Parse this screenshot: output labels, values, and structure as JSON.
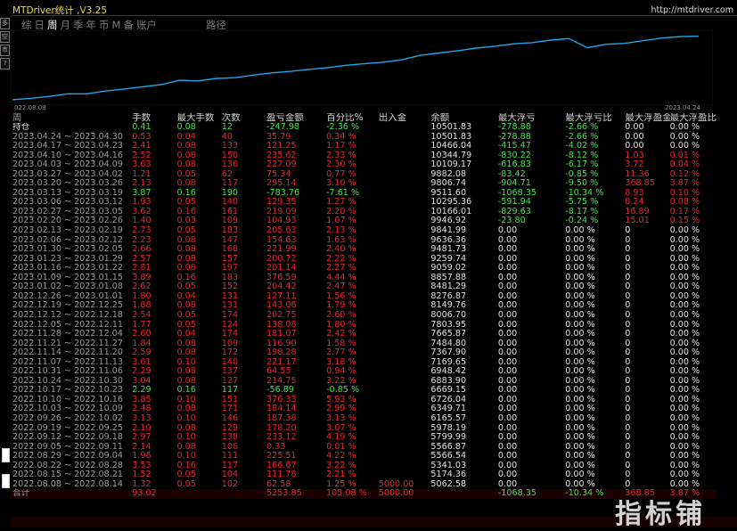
{
  "app": {
    "title": "MTDriver统计 ,V3.25",
    "url": "http://mtdriver.com"
  },
  "period_tabs": [
    {
      "label": "综",
      "active": false
    },
    {
      "label": "日",
      "active": false
    },
    {
      "label": "周",
      "active": true
    },
    {
      "label": "月",
      "active": false
    },
    {
      "label": "季",
      "active": false
    },
    {
      "label": "年",
      "active": false
    },
    {
      "label": "币",
      "active": false
    },
    {
      "label": "M",
      "active": false
    },
    {
      "label": "备",
      "active": false
    },
    {
      "label": "账户",
      "active": false
    }
  ],
  "extra_tab": "路径",
  "side_icons": [
    "多",
    "空",
    "市",
    "?"
  ],
  "chart": {
    "date_left": "022.08.08",
    "date_right": "2023.04.24",
    "line_color": "#1ea6e8"
  },
  "chart_data": {
    "type": "line",
    "x_range": [
      "2022.08.08",
      "2023.04.24"
    ],
    "values": [
      0,
      1,
      2,
      3,
      4,
      5,
      6,
      7,
      8,
      9,
      10,
      11,
      12,
      13,
      14,
      15,
      16,
      17,
      18,
      19,
      20,
      21,
      22,
      23,
      24,
      25,
      26,
      27,
      28,
      29,
      30,
      31,
      32,
      33,
      34,
      35,
      36
    ],
    "note_values_equity": [
      5062.58,
      5174.36,
      5341.03,
      5566.54,
      5566.87,
      5799.99,
      5978.19,
      6165.57,
      6349.71,
      6726.04,
      6669.15,
      6883.9,
      6948.42,
      7169.65,
      7367.9,
      7484.8,
      7665.87,
      7803.95,
      8006.7,
      8149.76,
      8276.87,
      8481.29,
      8857.88,
      9059.02,
      9259.74,
      9481.73,
      9636.36,
      9841.99,
      9946.92,
      10166.01,
      10295.36,
      9511.6,
      9806.74,
      9882.08,
      10109.17,
      10344.79,
      10466.04,
      10501.83
    ]
  },
  "table": {
    "headers": [
      "周",
      "手数",
      "最大手数",
      "次数",
      "盈亏金额",
      "百分比%",
      "出入金",
      "余额",
      "最大浮亏",
      "最大浮亏比",
      "最大浮盈金额",
      "最大浮盈比例"
    ],
    "open": {
      "label": "持仓",
      "lots": "0.41",
      "max_lots": "0.08",
      "count": "12",
      "pnl": "-247.98",
      "pct": "-2.36 %",
      "io": "",
      "balance": "10501.83",
      "max_float_loss": "-278.88",
      "max_float_loss_pct": "-2.66 %",
      "max_float_profit": "0.00",
      "max_float_profit_pct": "0.00 %"
    },
    "rows": [
      [
        "2023.04.24 ~ 2023.04.30",
        "0.53",
        "0.04",
        "40",
        "35.79",
        "0.34 %",
        "",
        "10501.83",
        "-278.88",
        "-2.66 %",
        "0.00",
        "0.00 %"
      ],
      [
        "2023.04.17 ~ 2023.04.23",
        "2.41",
        "0.08",
        "133",
        "121.25",
        "1.17 %",
        "",
        "10466.04",
        "-415.47",
        "-4.02 %",
        "0.00",
        "0.00 %"
      ],
      [
        "2023.04.10 ~ 2023.04.16",
        "2.52",
        "0.08",
        "150",
        "235.62",
        "2.33 %",
        "",
        "10344.79",
        "-830.22",
        "-8.12 %",
        "1.03",
        "0.01 %"
      ],
      [
        "2023.04.03 ~ 2023.04.09",
        "3.63",
        "0.08",
        "136",
        "227.09",
        "2.30 %",
        "",
        "10109.17",
        "-616.83",
        "-6.17 %",
        "3.72",
        "0.04 %"
      ],
      [
        "2023.03.27 ~ 2023.04.02",
        "1.21",
        "0.05",
        "62",
        "75.34",
        "0.77 %",
        "",
        "9882.08",
        "-83.42",
        "-0.85 %",
        "11.36",
        "0.12 %"
      ],
      [
        "2023.03.20 ~ 2023.03.26",
        "2.13",
        "0.08",
        "117",
        "295.14",
        "3.10 %",
        "",
        "9806.74",
        "-904.71",
        "-9.50 %",
        "368.85",
        "3.87 %"
      ],
      [
        "2023.03.13 ~ 2023.03.19",
        "3.87",
        "0.16",
        "190",
        "-783.76",
        "-7.61 %",
        "",
        "9511.60",
        "-1068.35",
        "-10.34 %",
        "8.93",
        "0.10 %"
      ],
      [
        "2023.03.06 ~ 2023.03.12",
        "1.93",
        "0.05",
        "140",
        "129.35",
        "1.27 %",
        "",
        "10295.36",
        "-591.94",
        "-5.75 %",
        "8.24",
        "0.08 %"
      ],
      [
        "2023.02.27 ~ 2023.03.05",
        "3.62",
        "0.16",
        "161",
        "219.09",
        "2.20 %",
        "",
        "10166.01",
        "-829.63",
        "-8.17 %",
        "16.89",
        "0.17 %"
      ],
      [
        "2023.02.20 ~ 2023.02.26",
        "1.40",
        "0.03",
        "109",
        "104.93",
        "1.07 %",
        "",
        "9946.92",
        "-23.80",
        "-0.24 %",
        "15.01",
        "0.15 %"
      ],
      [
        "2023.02.13 ~ 2023.02.19",
        "2.73",
        "0.05",
        "183",
        "205.63",
        "2.13 %",
        "",
        "9841.99",
        "0.00",
        "0.00 %",
        "0",
        "0.00 %"
      ],
      [
        "2023.02.06 ~ 2023.02.12",
        "2.23",
        "0.08",
        "147",
        "154.63",
        "1.63 %",
        "",
        "9636.36",
        "0.00",
        "0.00 %",
        "0",
        "0.00 %"
      ],
      [
        "2023.01.30 ~ 2023.02.05",
        "2.66",
        "0.08",
        "168",
        "221.99",
        "2.40 %",
        "",
        "9481.73",
        "0.00",
        "0.00 %",
        "0",
        "0.00 %"
      ],
      [
        "2023.01.23 ~ 2023.01.29",
        "2.57",
        "0.08",
        "157",
        "200.72",
        "2.22 %",
        "",
        "9259.74",
        "0.00",
        "0.00 %",
        "0",
        "0.00 %"
      ],
      [
        "2023.01.16 ~ 2023.01.22",
        "2.81",
        "0.08",
        "197",
        "201.14",
        "2.27 %",
        "",
        "9059.02",
        "0.00",
        "0.00 %",
        "0",
        "0.00 %"
      ],
      [
        "2023.01.09 ~ 2023.01.15",
        "3.89",
        "0.16",
        "183",
        "376.59",
        "4.44 %",
        "",
        "8857.88",
        "0.00",
        "0.00 %",
        "0",
        "0.00 %"
      ],
      [
        "2023.01.02 ~ 2023.01.08",
        "2.62",
        "0.05",
        "152",
        "204.42",
        "2.47 %",
        "",
        "8481.29",
        "0.00",
        "0.00 %",
        "0",
        "0.00 %"
      ],
      [
        "2022.12.26 ~ 2023.01.01",
        "1.80",
        "0.04",
        "131",
        "127.11",
        "1.56 %",
        "",
        "8276.87",
        "0.00",
        "0.00 %",
        "0",
        "0.00 %"
      ],
      [
        "2022.12.19 ~ 2022.12.25",
        "1.88",
        "0.08",
        "131",
        "143.06",
        "1.79 %",
        "",
        "8149.76",
        "0.00",
        "0.00 %",
        "0",
        "0.00 %"
      ],
      [
        "2022.12.12 ~ 2022.12.18",
        "2.54",
        "0.05",
        "174",
        "202.75",
        "2.60 %",
        "",
        "8006.70",
        "0.00",
        "0.00 %",
        "0",
        "0.00 %"
      ],
      [
        "2022.12.05 ~ 2022.12.11",
        "1.77",
        "0.05",
        "124",
        "138.08",
        "1.80 %",
        "",
        "7803.95",
        "0.00",
        "0.00 %",
        "0",
        "0.00 %"
      ],
      [
        "2022.11.28 ~ 2022.12.04",
        "2.60",
        "0.04",
        "174",
        "181.07",
        "2.42 %",
        "",
        "7665.87",
        "0.00",
        "0.00 %",
        "0",
        "0.00 %"
      ],
      [
        "2022.11.21 ~ 2022.11.27",
        "1.84",
        "0.08",
        "109",
        "116.90",
        "1.58 %",
        "",
        "7484.80",
        "0.00",
        "0.00 %",
        "0",
        "0.00 %"
      ],
      [
        "2022.11.14 ~ 2022.11.20",
        "2.59",
        "0.08",
        "172",
        "198.28",
        "2.77 %",
        "",
        "7367.90",
        "0.00",
        "0.00 %",
        "0",
        "0.00 %"
      ],
      [
        "2022.11.07 ~ 2022.11.13",
        "3.61",
        "0.10",
        "140",
        "221.17",
        "3.18 %",
        "",
        "7169.65",
        "0.00",
        "0.00 %",
        "0",
        "0.00 %"
      ],
      [
        "2022.10.31 ~ 2022.11.06",
        "2.29",
        "0.08",
        "137",
        "64.55",
        "0.94 %",
        "",
        "6948.42",
        "0.00",
        "0.00 %",
        "0",
        "0.00 %"
      ],
      [
        "2022.10.24 ~ 2022.10.30",
        "3.04",
        "0.08",
        "127",
        "214.75",
        "3.22 %",
        "",
        "6883.90",
        "0.00",
        "0.00 %",
        "0",
        "0.00 %"
      ],
      [
        "2022.10.17 ~ 2022.10.23",
        "2.29",
        "0.16",
        "117",
        "-56.89",
        "-0.85 %",
        "",
        "6669.15",
        "0.00",
        "0.00 %",
        "0",
        "0.00 %"
      ],
      [
        "2022.10.10 ~ 2022.10.16",
        "3.85",
        "0.10",
        "151",
        "376.33",
        "5.93 %",
        "",
        "6726.04",
        "0.00",
        "0.00 %",
        "0",
        "0.00 %"
      ],
      [
        "2022.10.03 ~ 2022.10.09",
        "2.48",
        "0.08",
        "171",
        "184.14",
        "2.99 %",
        "",
        "6349.71",
        "0.00",
        "0.00 %",
        "0",
        "0.00 %"
      ],
      [
        "2022.09.26 ~ 2022.10.02",
        "3.13",
        "0.10",
        "146",
        "187.38",
        "3.13 %",
        "",
        "6165.57",
        "0.00",
        "0.00 %",
        "0",
        "0.00 %"
      ],
      [
        "2022.09.19 ~ 2022.09.25",
        "2.10",
        "0.08",
        "129",
        "178.20",
        "3.07 %",
        "",
        "5978.19",
        "0.00",
        "0.00 %",
        "0",
        "0.00 %"
      ],
      [
        "2022.09.12 ~ 2022.09.18",
        "2.97",
        "0.10",
        "138",
        "233.12",
        "4.19 %",
        "",
        "5799.99",
        "0.00",
        "0.00 %",
        "0",
        "0.00 %"
      ],
      [
        "2022.09.05 ~ 2022.09.11",
        "2.14",
        "0.08",
        "106",
        "0.33",
        "0.01 %",
        "",
        "5566.87",
        "0.00",
        "0.00 %",
        "0",
        "0.00 %"
      ],
      [
        "2022.08.29 ~ 2022.09.04",
        "1.96",
        "0.10",
        "111",
        "225.51",
        "4.22 %",
        "",
        "5566.54",
        "0.00",
        "0.00 %",
        "0",
        "0.00 %"
      ],
      [
        "2022.08.22 ~ 2022.08.28",
        "3.53",
        "0.16",
        "117",
        "166.67",
        "3.22 %",
        "",
        "5341.03",
        "0.00",
        "0.00 %",
        "0",
        "0.00 %"
      ],
      [
        "2022.08.15 ~ 2022.08.21",
        "1.52",
        "0.05",
        "104",
        "111.78",
        "2.21 %",
        "",
        "5174.36",
        "0.00",
        "0.00 %",
        "0",
        "0.00 %"
      ],
      [
        "2022.08.08 ~ 2022.08.14",
        "1.32",
        "0.05",
        "102",
        "62.58",
        "1.25 %",
        "5000.00",
        "5062.58",
        "0.00",
        "0.00 %",
        "0",
        "0.00 %"
      ]
    ],
    "total": {
      "label": "合计",
      "lots": "93.02",
      "max_lots": "",
      "count": "",
      "pnl": "5253.85",
      "pct": "105.08 %",
      "io": "5000.00",
      "balance": "",
      "max_float_loss": "-1068.35",
      "max_float_loss_pct": "-10.34 %",
      "max_float_profit": "368.85",
      "max_float_profit_pct": "3.87 %"
    }
  },
  "watermark": "指标铺"
}
